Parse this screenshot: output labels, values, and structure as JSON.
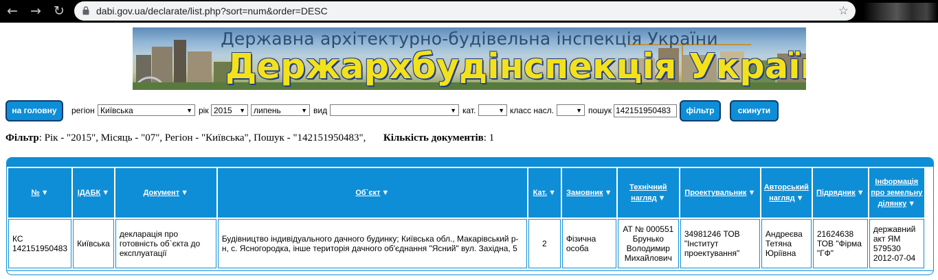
{
  "browser": {
    "url": "dabi.gov.ua/declarate/list.php?sort=num&order=DESC",
    "icons": [
      "back-arrow-icon",
      "forward-arrow-icon",
      "reload-icon",
      "lock-icon",
      "star-icon"
    ]
  },
  "banner": {
    "line1": "Державна архітектурно-будівельна інспекція України",
    "line2": "Держархбудінспекція України"
  },
  "toolbar": {
    "home_button": "на головну",
    "region_label": "регіон",
    "region_value": "Київська",
    "year_label": "рік",
    "year_value": "2015",
    "month_value": "липень",
    "type_label": "вид",
    "type_value": "",
    "cat_label": "кат.",
    "cat_value": "",
    "class_label": "класс насл.",
    "class_value": "",
    "search_label": "пошук",
    "search_value": "142151950483",
    "filter_button": "фільтр",
    "reset_button": "скинути"
  },
  "filter_summary": {
    "filter_label": "Фільтр",
    "filter_text": ": Рік - \"2015\", Місяць - \"07\", Регіон - \"Київська\", Пошук - \"142151950483\",",
    "count_label": "Кількість документів",
    "count_text": ": 1"
  },
  "table": {
    "headers": [
      "№",
      "ІДАБК",
      "Документ",
      "Об`єкт",
      "Кат.",
      "Замовник",
      "Технічний нагляд",
      "Проектувальник",
      "Авторський нагляд",
      "Підрядник",
      "Інформація про земельну ділянку"
    ],
    "rows": [
      [
        "КС 142151950483",
        "Київська",
        "декларація про готовність об`єкта до експлуатації",
        "Будівництво індивідуального дачного будинку; Київська обл., Макарівський р-н, с. Ясногородка, інше територія дачного об'єднання \"Ясний\" вул. Західна, 5",
        "2",
        "Фізична особа",
        "АТ № 000551 Брунько Володимир Михайлович",
        "34981246 ТОВ \"Інститут проектування\"",
        "Андреєва Тетяна Юріївна",
        "21624638 ТОВ \"Фірма \"ГФ\"",
        "державний акт ЯМ 579530 2012-07-04"
      ]
    ]
  },
  "colors": {
    "accent": "#0e8ed6",
    "button_border": "#0a3b6e",
    "banner_title": "#f3e21a"
  }
}
